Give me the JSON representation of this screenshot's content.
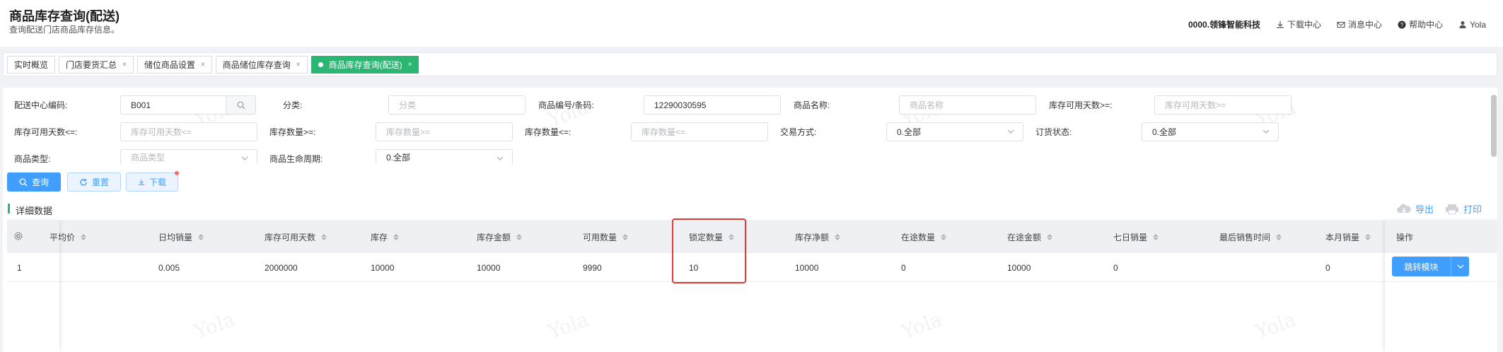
{
  "header": {
    "title": "商品库存查询(配送)",
    "subtitle": "查询配送门店商品库存信息。",
    "company": "0000.领锋智能科技",
    "download_center": "下载中心",
    "message_center": "消息中心",
    "help_center": "帮助中心",
    "user": "Yola"
  },
  "tabs": [
    {
      "label": "实时概览",
      "closable": false,
      "active": false
    },
    {
      "label": "门店要货汇总",
      "closable": true,
      "active": false
    },
    {
      "label": "储位商品设置",
      "closable": true,
      "active": false
    },
    {
      "label": "商品储位库存查询",
      "closable": true,
      "active": false
    },
    {
      "label": "商品库存查询(配送)",
      "closable": true,
      "active": true
    }
  ],
  "tab_close": "×",
  "filters": {
    "dc_code_label": "配送中心编码:",
    "dc_code_value": "B001",
    "category_label": "分类:",
    "category_placeholder": "分类",
    "sku_label": "商品编号/条码:",
    "sku_value": "12290030595",
    "name_label": "商品名称:",
    "name_placeholder": "商品名称",
    "days_gte_label": "库存可用天数>=:",
    "days_gte_placeholder": "库存可用天数>=",
    "days_lte_label": "库存可用天数<=:",
    "days_lte_placeholder": "库存可用天数<=",
    "qty_gte_label": "库存数量>=:",
    "qty_gte_placeholder": "库存数量>=",
    "qty_lte_label": "库存数量<=:",
    "qty_lte_placeholder": "库存数量<=",
    "trade_label": "交易方式:",
    "trade_value": "0.全部",
    "order_status_label": "订货状态:",
    "order_status_value": "0.全部",
    "type_label": "商品类型:",
    "type_placeholder": "商品类型",
    "lifecycle_label": "商品生命周期:",
    "lifecycle_value": "0.全部"
  },
  "buttons": {
    "query": "查询",
    "reset": "重置",
    "download": "下载",
    "export": "导出",
    "print": "打印"
  },
  "section_title": "详细数据",
  "table": {
    "columns": [
      "移动平均价",
      "日均销量",
      "库存可用天数",
      "库存",
      "库存金额",
      "可用数量",
      "锁定数量",
      "库存净额",
      "在途数量",
      "在途金额",
      "七日销量",
      "最后销售时间",
      "本月销量"
    ],
    "action_column": "操作",
    "rows": [
      {
        "index": "1",
        "cells": [
          "",
          "0.005",
          "2000000",
          "10000",
          "10000",
          "9990",
          "10",
          "10000",
          "0",
          "10000",
          "0",
          "",
          "0"
        ],
        "action": "跳转模块"
      }
    ]
  },
  "watermark": "Yola",
  "colors": {
    "accent_green": "#2bb673",
    "primary_blue": "#409eff",
    "highlight_red": "#e53935"
  }
}
